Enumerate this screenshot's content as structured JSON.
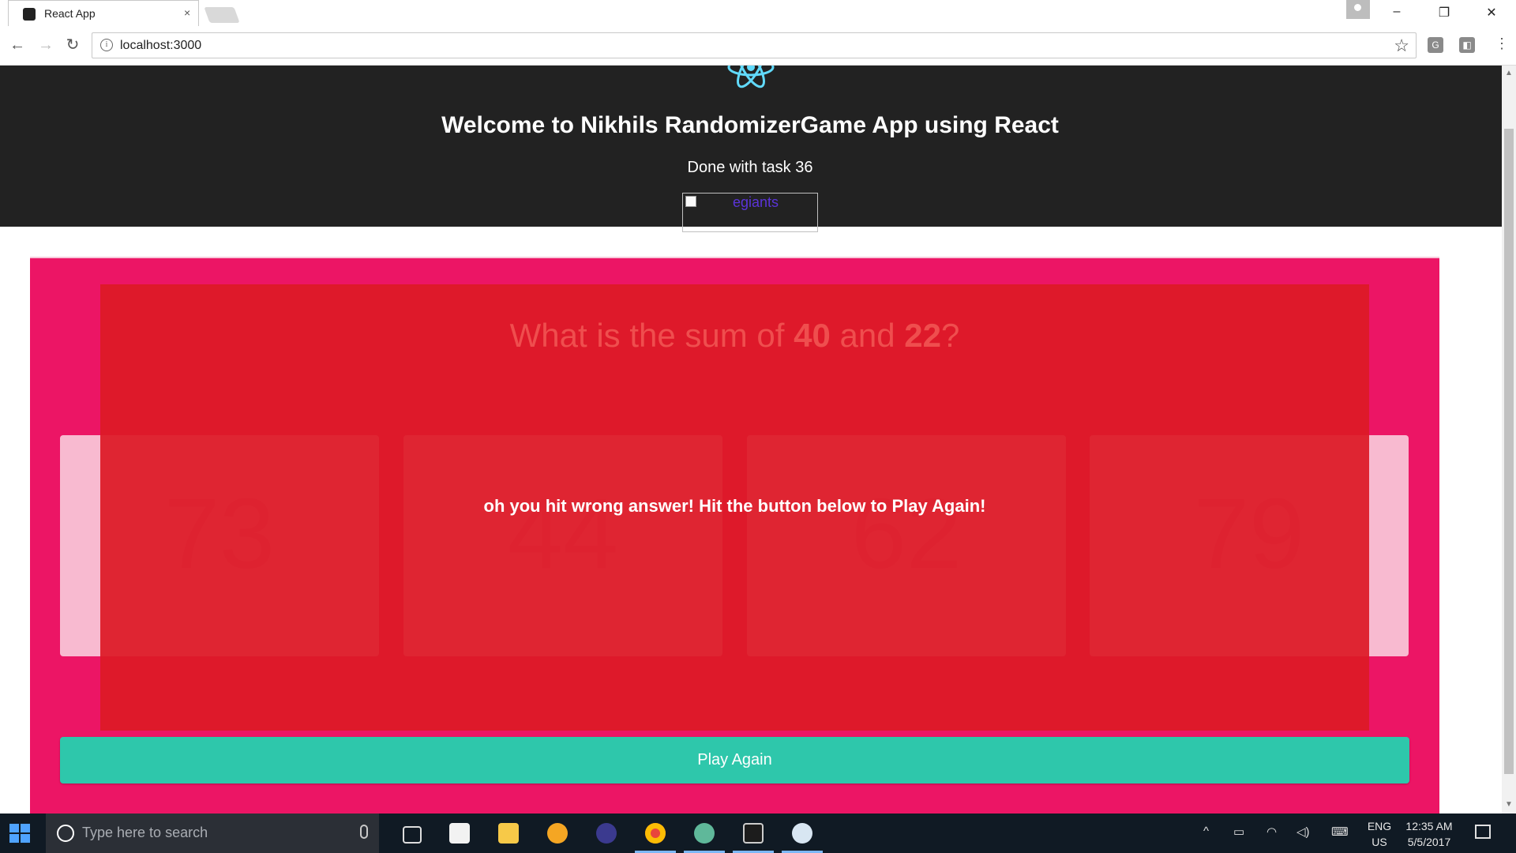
{
  "browser": {
    "tab_title": "React App",
    "tab_close": "×",
    "window_controls": {
      "minimize": "–",
      "restore": "❐",
      "close": "✕"
    },
    "nav": {
      "back": "←",
      "forward": "→",
      "reload": "↻"
    },
    "address": {
      "info": "i",
      "url": "localhost:3000"
    },
    "bookmark_star": "☆",
    "extensions": [
      "G",
      "◧"
    ],
    "menu": "⋮"
  },
  "header": {
    "title": "Welcome to Nikhils RandomizerGame App using React",
    "task_status": "Done with task 36",
    "image_alt": "egiants"
  },
  "game": {
    "question_prefix": "What is the sum of",
    "num_a": "40",
    "conj": "and",
    "num_b": "22",
    "question_suffix": "?",
    "options": [
      "73",
      "44",
      "62",
      "79"
    ],
    "result_message": "oh you hit wrong answer! Hit the button below to Play Again!",
    "play_again_label": "Play Again"
  },
  "colors": {
    "header_bg": "#222222",
    "panel_bg": "#ec1565",
    "overlay_bg": "#dd1a26",
    "card_bg": "#f8bad0",
    "button_bg": "#2ec7ab"
  },
  "taskbar": {
    "search_placeholder": "Type here to search",
    "lang_top": "ENG",
    "lang_bottom": "US",
    "time": "12:35 AM",
    "date": "5/5/2017",
    "tray_chevron": "^"
  }
}
